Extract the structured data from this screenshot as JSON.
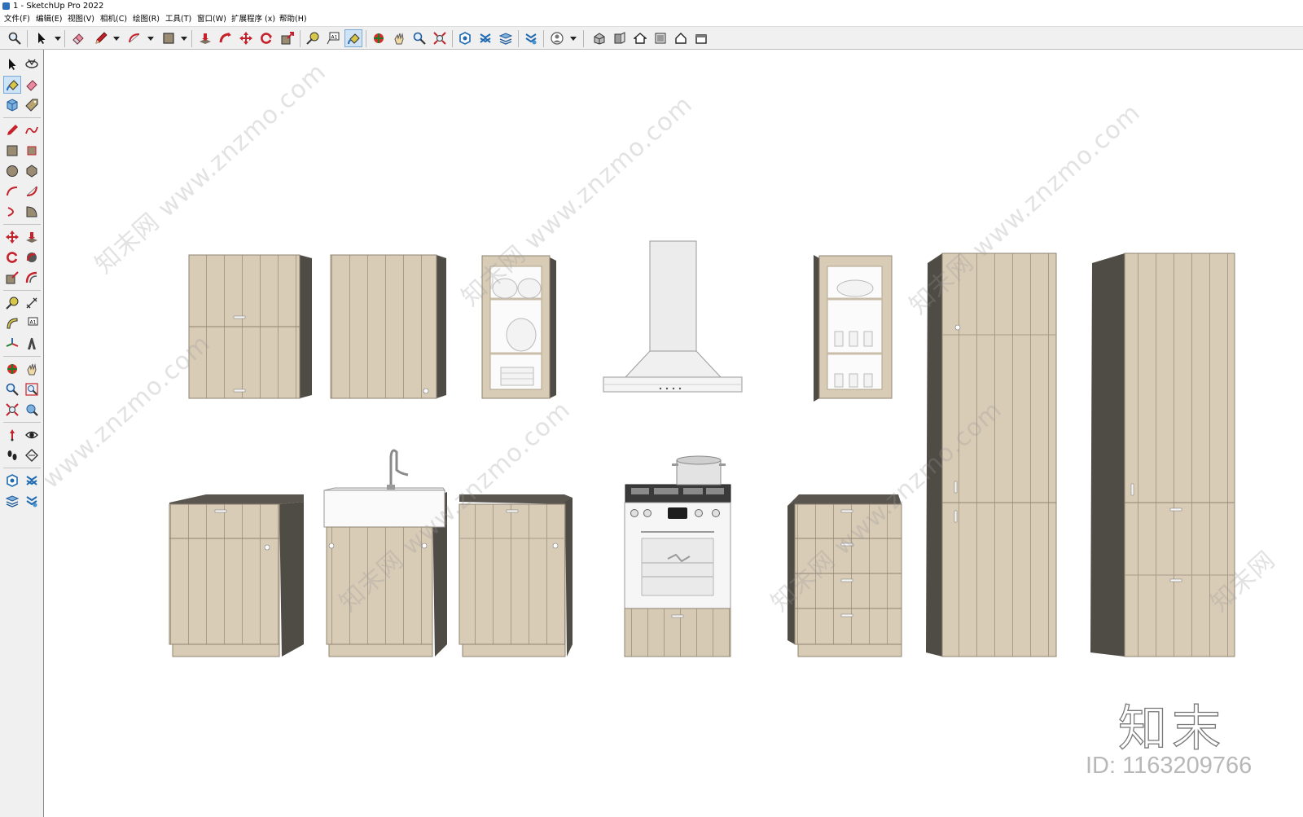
{
  "window": {
    "title": "1 - SketchUp Pro 2022"
  },
  "menu": [
    "文件(F)",
    "编辑(E)",
    "视图(V)",
    "相机(C)",
    "绘图(R)",
    "工具(T)",
    "窗口(W)",
    "扩展程序 (x)",
    "帮助(H)"
  ],
  "toolbar": {
    "tools": [
      "zoom-icon",
      "select-icon",
      "eraser-icon",
      "pencil-icon",
      "arc-icon",
      "rectangle-icon",
      "pushpull-icon",
      "followme-icon",
      "move-icon",
      "rotate-icon",
      "scale-icon",
      "tape-icon",
      "text-icon",
      "paint-icon",
      "orbit-icon",
      "pan-icon",
      "zoom-window-icon",
      "zoom-extents-icon",
      "warehouse-icon",
      "extension-icon",
      "layers-icon",
      "sandbox-icon",
      "profile-icon",
      "iso-view-icon",
      "front-view-icon",
      "home-icon",
      "top-view-icon",
      "house-icon",
      "back-view-icon"
    ],
    "active": "paint-icon"
  },
  "lefttools": {
    "active": "paint-icon"
  },
  "watermark": {
    "text": "www.znzmo.com",
    "cn": "知末网"
  },
  "brand": {
    "logo": "知末",
    "id": "ID: 1163209766"
  },
  "colors": {
    "panel": "#d8ccb7",
    "panel_dark": "#c8bba4",
    "side": "#4f4b45",
    "groove": "#a89c88",
    "hood": "#eeeeee"
  }
}
